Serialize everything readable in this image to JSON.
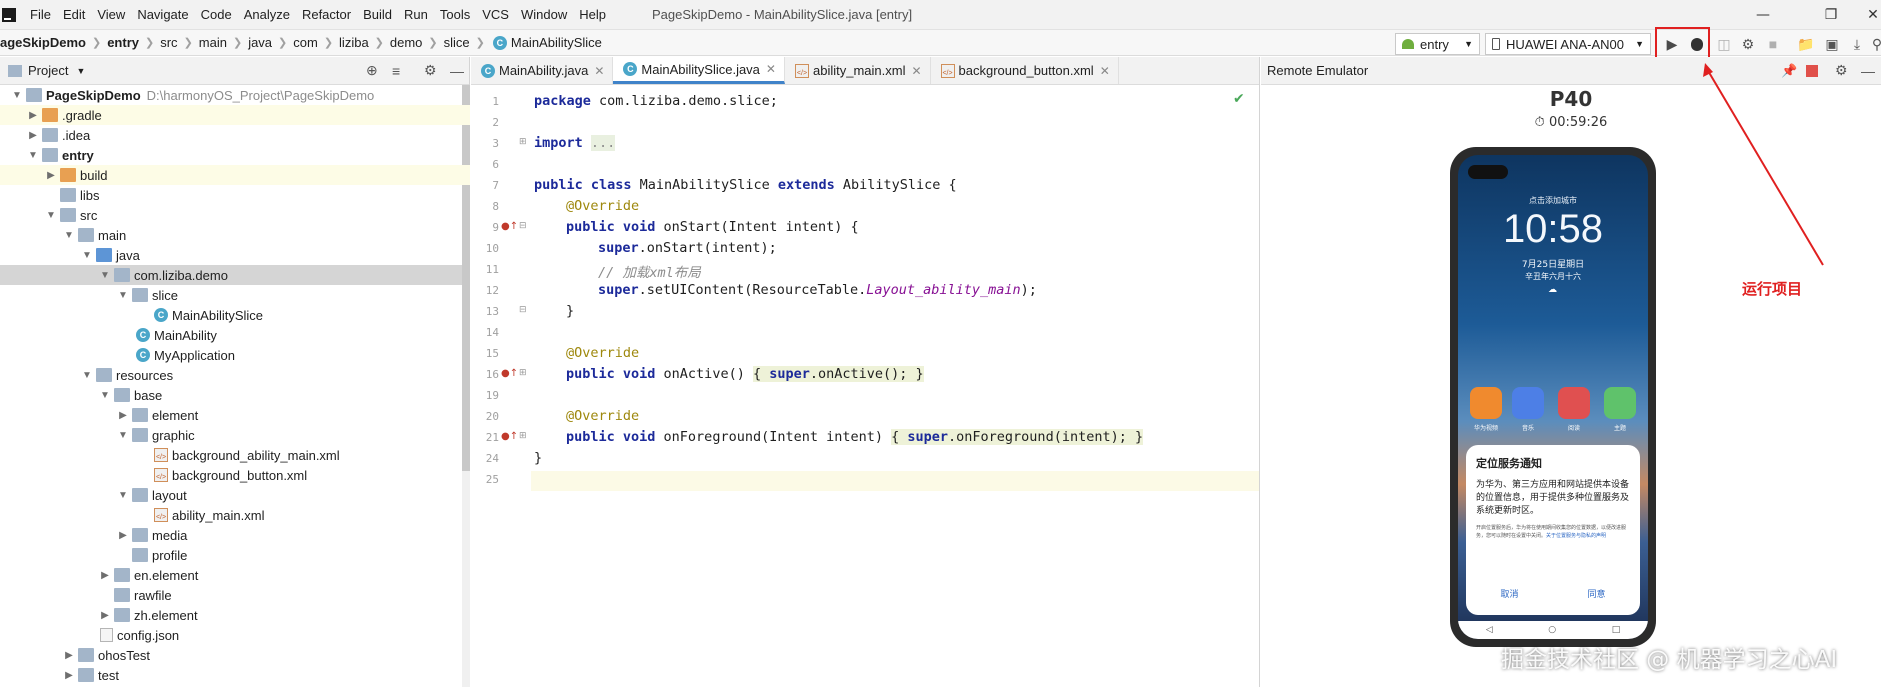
{
  "menubar": {
    "items": [
      "File",
      "Edit",
      "View",
      "Navigate",
      "Code",
      "Analyze",
      "Refactor",
      "Build",
      "Run",
      "Tools",
      "VCS",
      "Window",
      "Help"
    ],
    "title": "PageSkipDemo - MainAbilitySlice.java [entry]"
  },
  "navbar": {
    "crumbs": [
      "ageSkipDemo",
      "entry",
      "src",
      "main",
      "java",
      "com",
      "liziba",
      "demo",
      "slice",
      "MainAbilitySlice"
    ],
    "config": "entry",
    "device": "HUAWEI ANA-AN00"
  },
  "project": {
    "title": "Project",
    "tree": [
      {
        "label": "PageSkipDemo",
        "hint": "D:\\harmonyOS_Project\\PageSkipDemo"
      },
      {
        "label": ".gradle"
      },
      {
        "label": ".idea"
      },
      {
        "label": "entry"
      },
      {
        "label": "build"
      },
      {
        "label": "libs"
      },
      {
        "label": "src"
      },
      {
        "label": "main"
      },
      {
        "label": "java"
      },
      {
        "label": "com.liziba.demo"
      },
      {
        "label": "slice"
      },
      {
        "label": "MainAbilitySlice"
      },
      {
        "label": "MainAbility"
      },
      {
        "label": "MyApplication"
      },
      {
        "label": "resources"
      },
      {
        "label": "base"
      },
      {
        "label": "element"
      },
      {
        "label": "graphic"
      },
      {
        "label": "background_ability_main.xml"
      },
      {
        "label": "background_button.xml"
      },
      {
        "label": "layout"
      },
      {
        "label": "ability_main.xml"
      },
      {
        "label": "media"
      },
      {
        "label": "profile"
      },
      {
        "label": "en.element"
      },
      {
        "label": "rawfile"
      },
      {
        "label": "zh.element"
      },
      {
        "label": "config.json"
      },
      {
        "label": "ohosTest"
      },
      {
        "label": "test"
      }
    ]
  },
  "editor": {
    "tabs": [
      "MainAbility.java",
      "MainAbilitySlice.java",
      "ability_main.xml",
      "background_button.xml"
    ],
    "line_numbers": [
      "1",
      "2",
      "3",
      "6",
      "7",
      "8",
      "9",
      "10",
      "11",
      "12",
      "13",
      "14",
      "15",
      "16",
      "19",
      "20",
      "21",
      "24",
      "25"
    ],
    "code": {
      "l1a": "package ",
      "l1b": "com.liziba.demo.slice;",
      "l3a": "import ",
      "l3b": "...",
      "l7a": "public class ",
      "l7b": "MainAbilitySlice ",
      "l7c": "extends ",
      "l7d": "AbilitySlice {",
      "l8": "@Override",
      "l9a": "public void ",
      "l9b": "onStart(Intent intent) {",
      "l10a": "super",
      "l10b": ".onStart(intent);",
      "l11": "// 加载xml布局",
      "l12a": "super",
      "l12b": ".setUIContent(ResourceTable.",
      "l12c": "Layout_ability_main",
      "l12d": ");",
      "l13": "}",
      "l15": "@Override",
      "l16a": "public void ",
      "l16b": "onActive() ",
      "l16c": "{ ",
      "l16d": "super",
      "l16e": ".onActive(); ",
      "l16f": "}",
      "l20": "@Override",
      "l21a": "public void ",
      "l21b": "onForeground(Intent intent) ",
      "l21c": "{ ",
      "l21d": "super",
      "l21e": ".onForeground(intent); ",
      "l21f": "}",
      "l24": "}"
    }
  },
  "emulator": {
    "title": "Remote Emulator",
    "device_name": "P40",
    "timer": "00:59:26",
    "lock_city": "点击添加城市",
    "clock": "10:58",
    "date": "7月25日星期日",
    "lunar": "辛丑年六月十六",
    "apps": [
      "华为视频",
      "音乐",
      "阅读",
      "主题"
    ],
    "dialog": {
      "title": "定位服务通知",
      "body": "为华为、第三方应用和网站提供本设备的位置信息，用于提供多种位置服务及系统更新时区。",
      "small": "开启位置服务后，华为将在使用期间收集您的位置数据，以便改进服务，您可以随时在设置中关闭。",
      "link": "关于位置服务与隐私的声明",
      "cancel": "取消",
      "agree": "同意"
    }
  },
  "annotation": {
    "label": "运行项目",
    "color": "#e02020"
  },
  "watermark": "掘金技术社区 @ 机器学习之心AI"
}
